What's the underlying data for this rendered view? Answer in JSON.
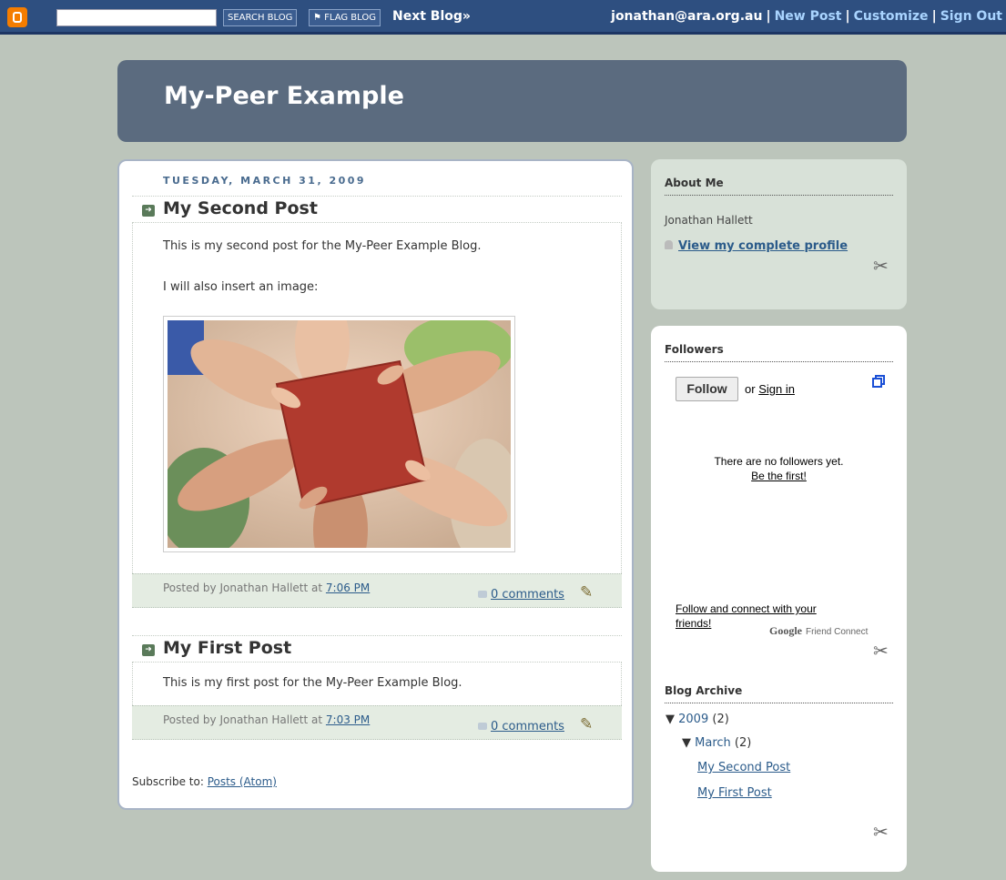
{
  "navbar": {
    "search_button": "SEARCH BLOG",
    "flag_button": "FLAG BLOG",
    "next_blog": "Next Blog»",
    "user_email": "jonathan@ara.org.au",
    "new_post": "New Post",
    "customize": "Customize",
    "sign_out": "Sign Out",
    "separator": "|"
  },
  "header": {
    "title": "My-Peer Example"
  },
  "main": {
    "date": "TUESDAY, MARCH 31, 2009",
    "posts": [
      {
        "title": "My Second Post",
        "paragraphs": [
          "This is my second post for the My-Peer Example Blog.",
          "I will also insert an image:"
        ],
        "posted_by": "Posted by Jonathan Hallett at",
        "time": "7:06 PM",
        "comments": "0 comments"
      },
      {
        "title": "My First Post",
        "paragraphs": [
          "This is my first post for the My-Peer Example Blog."
        ],
        "posted_by": "Posted by Jonathan Hallett at",
        "time": "7:03 PM",
        "comments": "0 comments"
      }
    ],
    "subscribe_label": "Subscribe to:",
    "subscribe_link": "Posts (Atom)"
  },
  "sidebar": {
    "about": {
      "title": "About Me",
      "name": "Jonathan Hallett",
      "profile_link": "View my complete profile"
    },
    "followers": {
      "title": "Followers",
      "follow_button": "Follow",
      "or": "or",
      "sign_in": "Sign in",
      "no_followers": "There are no followers yet.",
      "be_first": "Be the first!",
      "connect_text": "Follow and connect with your friends!",
      "google": "Google",
      "friend_connect": "Friend Connect"
    },
    "archive": {
      "title": "Blog Archive",
      "year": "2009",
      "year_count": "(2)",
      "month": "March",
      "month_count": "(2)",
      "posts": [
        "My Second Post",
        "My First Post"
      ]
    }
  }
}
